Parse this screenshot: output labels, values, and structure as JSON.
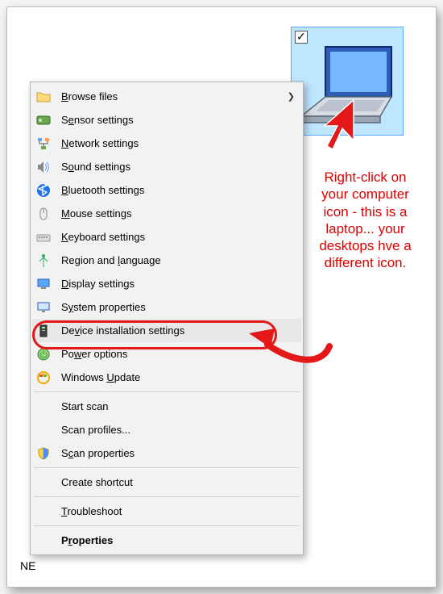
{
  "tile": {
    "checked": true
  },
  "annotation": "Right-click on your computer icon - this is a laptop... your desktops hve a different icon.",
  "menu": {
    "browse": "Browse files",
    "sensor": "Sensor settings",
    "network": "Network settings",
    "sound": "Sound settings",
    "bluetooth": "Bluetooth settings",
    "mouse": "Mouse settings",
    "keyboard": "Keyboard settings",
    "region": "Region and language",
    "display": "Display settings",
    "system": "System properties",
    "device_install": "Device installation settings",
    "power": "Power options",
    "windows_update": "Windows Update",
    "start_scan": "Start scan",
    "scan_profiles": "Scan profiles...",
    "scan_properties": "Scan properties",
    "create_shortcut": "Create shortcut",
    "troubleshoot": "Troubleshoot",
    "properties": "Properties"
  },
  "stray": "NE"
}
